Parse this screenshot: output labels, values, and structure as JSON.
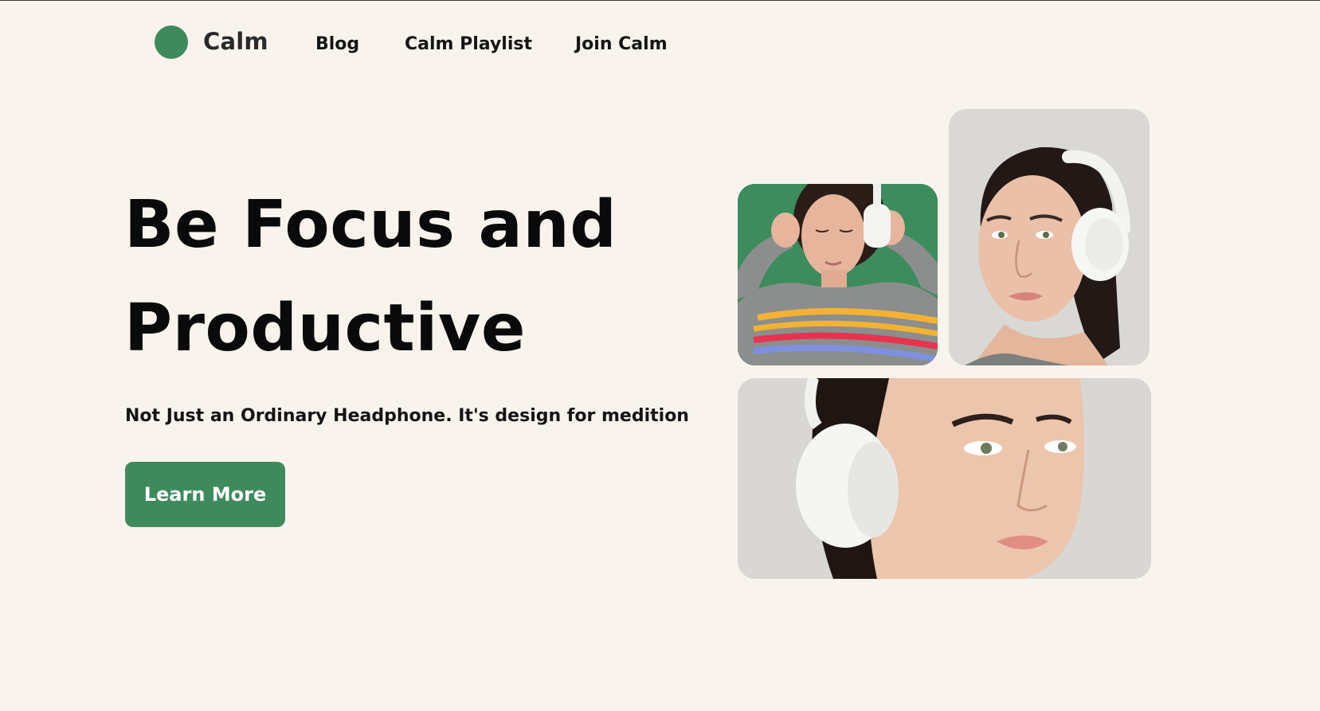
{
  "brand": {
    "name": "Calm",
    "accent_color": "#3e8a5c",
    "background_color": "#f8f4ed"
  },
  "nav": {
    "links": [
      "Blog",
      "Calm Playlist",
      "Join Calm"
    ]
  },
  "hero": {
    "title_line_1": "Be Focus and",
    "title_line_2": "Productive",
    "subtitle": "Not Just an Ordinary Headphone. It's design for medition",
    "cta_label": "Learn More"
  },
  "gallery": {
    "images": [
      {
        "icon": "photo-woman-headphones-green-backdrop",
        "backdrop": "#3d8c5d"
      },
      {
        "icon": "photo-woman-headphones-profile",
        "backdrop": "#d9d8d4"
      },
      {
        "icon": "photo-woman-headphones-closeup",
        "backdrop": "#d8d7d3"
      }
    ]
  }
}
